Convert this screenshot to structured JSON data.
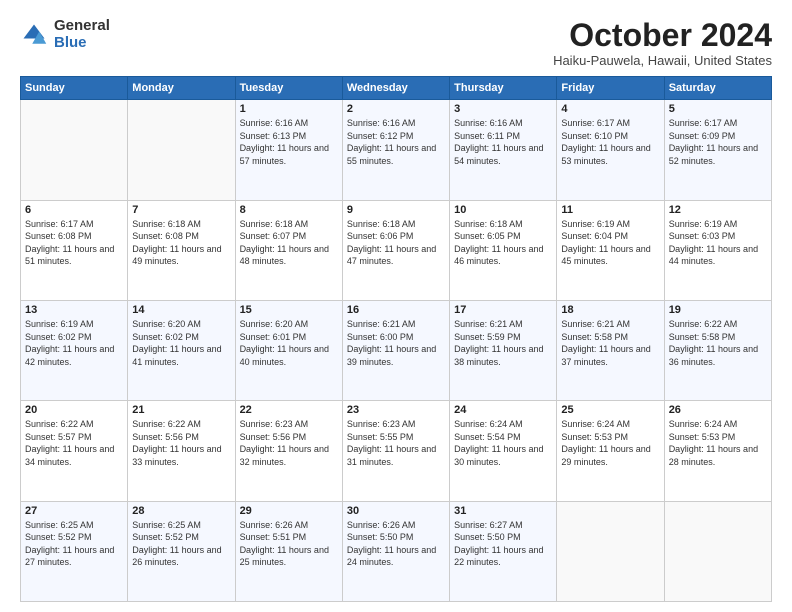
{
  "logo": {
    "general": "General",
    "blue": "Blue"
  },
  "title": "October 2024",
  "location": "Haiku-Pauwela, Hawaii, United States",
  "weekdays": [
    "Sunday",
    "Monday",
    "Tuesday",
    "Wednesday",
    "Thursday",
    "Friday",
    "Saturday"
  ],
  "weeks": [
    [
      {
        "num": "",
        "sunrise": "",
        "sunset": "",
        "daylight": ""
      },
      {
        "num": "",
        "sunrise": "",
        "sunset": "",
        "daylight": ""
      },
      {
        "num": "1",
        "sunrise": "Sunrise: 6:16 AM",
        "sunset": "Sunset: 6:13 PM",
        "daylight": "Daylight: 11 hours and 57 minutes."
      },
      {
        "num": "2",
        "sunrise": "Sunrise: 6:16 AM",
        "sunset": "Sunset: 6:12 PM",
        "daylight": "Daylight: 11 hours and 55 minutes."
      },
      {
        "num": "3",
        "sunrise": "Sunrise: 6:16 AM",
        "sunset": "Sunset: 6:11 PM",
        "daylight": "Daylight: 11 hours and 54 minutes."
      },
      {
        "num": "4",
        "sunrise": "Sunrise: 6:17 AM",
        "sunset": "Sunset: 6:10 PM",
        "daylight": "Daylight: 11 hours and 53 minutes."
      },
      {
        "num": "5",
        "sunrise": "Sunrise: 6:17 AM",
        "sunset": "Sunset: 6:09 PM",
        "daylight": "Daylight: 11 hours and 52 minutes."
      }
    ],
    [
      {
        "num": "6",
        "sunrise": "Sunrise: 6:17 AM",
        "sunset": "Sunset: 6:08 PM",
        "daylight": "Daylight: 11 hours and 51 minutes."
      },
      {
        "num": "7",
        "sunrise": "Sunrise: 6:18 AM",
        "sunset": "Sunset: 6:08 PM",
        "daylight": "Daylight: 11 hours and 49 minutes."
      },
      {
        "num": "8",
        "sunrise": "Sunrise: 6:18 AM",
        "sunset": "Sunset: 6:07 PM",
        "daylight": "Daylight: 11 hours and 48 minutes."
      },
      {
        "num": "9",
        "sunrise": "Sunrise: 6:18 AM",
        "sunset": "Sunset: 6:06 PM",
        "daylight": "Daylight: 11 hours and 47 minutes."
      },
      {
        "num": "10",
        "sunrise": "Sunrise: 6:18 AM",
        "sunset": "Sunset: 6:05 PM",
        "daylight": "Daylight: 11 hours and 46 minutes."
      },
      {
        "num": "11",
        "sunrise": "Sunrise: 6:19 AM",
        "sunset": "Sunset: 6:04 PM",
        "daylight": "Daylight: 11 hours and 45 minutes."
      },
      {
        "num": "12",
        "sunrise": "Sunrise: 6:19 AM",
        "sunset": "Sunset: 6:03 PM",
        "daylight": "Daylight: 11 hours and 44 minutes."
      }
    ],
    [
      {
        "num": "13",
        "sunrise": "Sunrise: 6:19 AM",
        "sunset": "Sunset: 6:02 PM",
        "daylight": "Daylight: 11 hours and 42 minutes."
      },
      {
        "num": "14",
        "sunrise": "Sunrise: 6:20 AM",
        "sunset": "Sunset: 6:02 PM",
        "daylight": "Daylight: 11 hours and 41 minutes."
      },
      {
        "num": "15",
        "sunrise": "Sunrise: 6:20 AM",
        "sunset": "Sunset: 6:01 PM",
        "daylight": "Daylight: 11 hours and 40 minutes."
      },
      {
        "num": "16",
        "sunrise": "Sunrise: 6:21 AM",
        "sunset": "Sunset: 6:00 PM",
        "daylight": "Daylight: 11 hours and 39 minutes."
      },
      {
        "num": "17",
        "sunrise": "Sunrise: 6:21 AM",
        "sunset": "Sunset: 5:59 PM",
        "daylight": "Daylight: 11 hours and 38 minutes."
      },
      {
        "num": "18",
        "sunrise": "Sunrise: 6:21 AM",
        "sunset": "Sunset: 5:58 PM",
        "daylight": "Daylight: 11 hours and 37 minutes."
      },
      {
        "num": "19",
        "sunrise": "Sunrise: 6:22 AM",
        "sunset": "Sunset: 5:58 PM",
        "daylight": "Daylight: 11 hours and 36 minutes."
      }
    ],
    [
      {
        "num": "20",
        "sunrise": "Sunrise: 6:22 AM",
        "sunset": "Sunset: 5:57 PM",
        "daylight": "Daylight: 11 hours and 34 minutes."
      },
      {
        "num": "21",
        "sunrise": "Sunrise: 6:22 AM",
        "sunset": "Sunset: 5:56 PM",
        "daylight": "Daylight: 11 hours and 33 minutes."
      },
      {
        "num": "22",
        "sunrise": "Sunrise: 6:23 AM",
        "sunset": "Sunset: 5:56 PM",
        "daylight": "Daylight: 11 hours and 32 minutes."
      },
      {
        "num": "23",
        "sunrise": "Sunrise: 6:23 AM",
        "sunset": "Sunset: 5:55 PM",
        "daylight": "Daylight: 11 hours and 31 minutes."
      },
      {
        "num": "24",
        "sunrise": "Sunrise: 6:24 AM",
        "sunset": "Sunset: 5:54 PM",
        "daylight": "Daylight: 11 hours and 30 minutes."
      },
      {
        "num": "25",
        "sunrise": "Sunrise: 6:24 AM",
        "sunset": "Sunset: 5:53 PM",
        "daylight": "Daylight: 11 hours and 29 minutes."
      },
      {
        "num": "26",
        "sunrise": "Sunrise: 6:24 AM",
        "sunset": "Sunset: 5:53 PM",
        "daylight": "Daylight: 11 hours and 28 minutes."
      }
    ],
    [
      {
        "num": "27",
        "sunrise": "Sunrise: 6:25 AM",
        "sunset": "Sunset: 5:52 PM",
        "daylight": "Daylight: 11 hours and 27 minutes."
      },
      {
        "num": "28",
        "sunrise": "Sunrise: 6:25 AM",
        "sunset": "Sunset: 5:52 PM",
        "daylight": "Daylight: 11 hours and 26 minutes."
      },
      {
        "num": "29",
        "sunrise": "Sunrise: 6:26 AM",
        "sunset": "Sunset: 5:51 PM",
        "daylight": "Daylight: 11 hours and 25 minutes."
      },
      {
        "num": "30",
        "sunrise": "Sunrise: 6:26 AM",
        "sunset": "Sunset: 5:50 PM",
        "daylight": "Daylight: 11 hours and 24 minutes."
      },
      {
        "num": "31",
        "sunrise": "Sunrise: 6:27 AM",
        "sunset": "Sunset: 5:50 PM",
        "daylight": "Daylight: 11 hours and 22 minutes."
      },
      {
        "num": "",
        "sunrise": "",
        "sunset": "",
        "daylight": ""
      },
      {
        "num": "",
        "sunrise": "",
        "sunset": "",
        "daylight": ""
      }
    ]
  ]
}
